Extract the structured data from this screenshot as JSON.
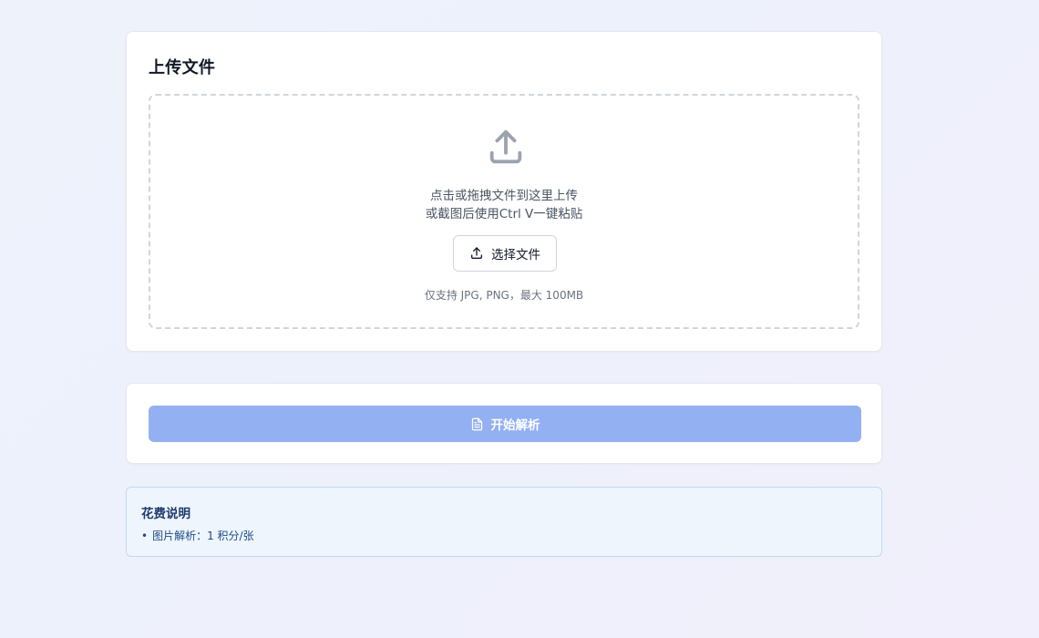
{
  "upload": {
    "title": "上传文件",
    "drop_line1": "点击或拖拽文件到这里上传",
    "drop_line2": "或截图后使用Ctrl V一键粘贴",
    "choose_button": "选择文件",
    "hint": "仅支持 JPG, PNG，最大 100MB",
    "icons": {
      "big": "upload-icon",
      "button": "upload-icon"
    }
  },
  "action": {
    "start_button": "开始解析",
    "start_icon": "document-icon",
    "disabled": true
  },
  "cost": {
    "title": "花费说明",
    "items": [
      {
        "bullet": "•",
        "text": "图片解析：1 积分/张"
      }
    ]
  },
  "colors": {
    "primary_disabled": "#93b0f3",
    "info_background": "#eef5fd",
    "info_border": "#bfdbf1"
  }
}
